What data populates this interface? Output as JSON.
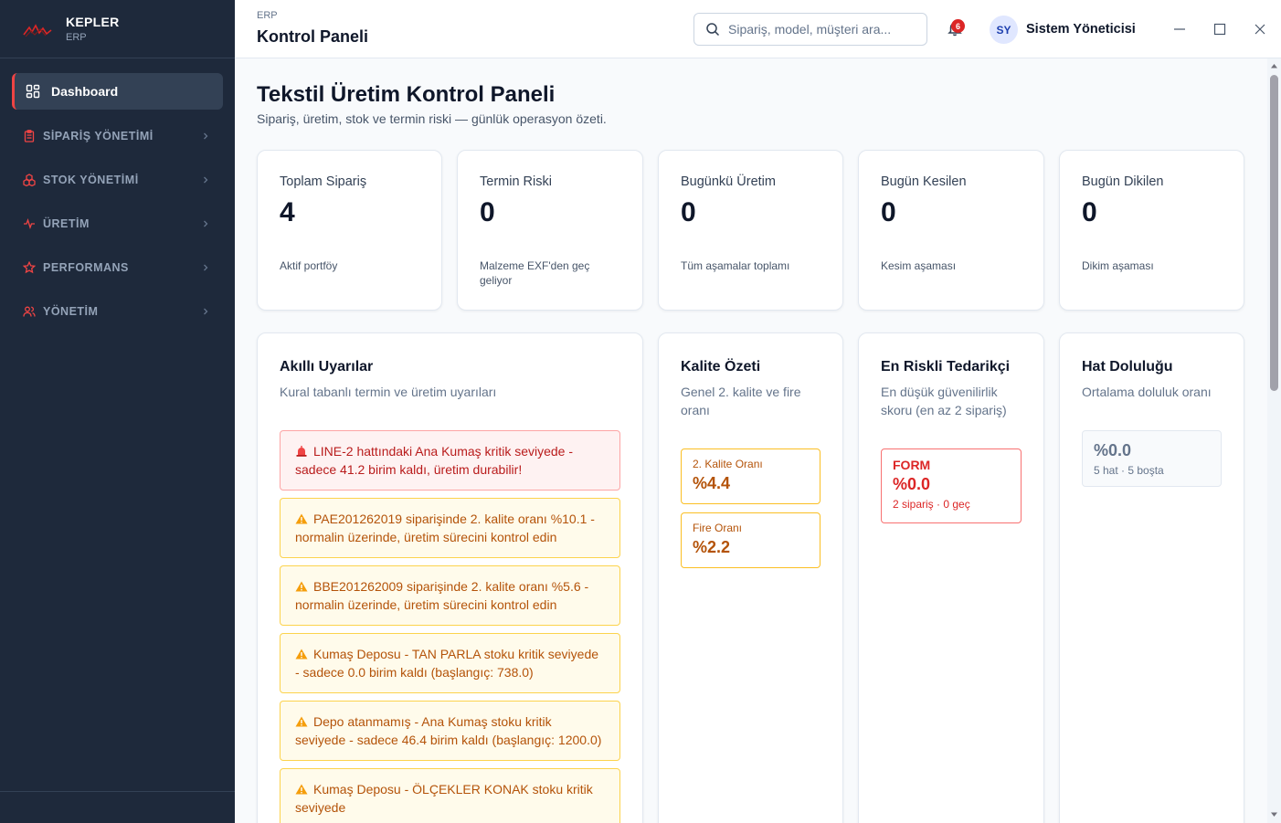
{
  "brand": {
    "name": "KEPLER",
    "sub": "ERP"
  },
  "sidebar": {
    "active": {
      "label": "Dashboard"
    },
    "items": [
      {
        "label": "SİPARİŞ YÖNETİMİ"
      },
      {
        "label": "STOK YÖNETİMİ"
      },
      {
        "label": "ÜRETİM"
      },
      {
        "label": "PERFORMANS"
      },
      {
        "label": "YÖNETİM"
      }
    ]
  },
  "header": {
    "breadcrumb": "ERP",
    "title": "Kontrol Paneli",
    "search_placeholder": "Sipariş, model, müşteri ara...",
    "notification_count": "6",
    "avatar_initials": "SY",
    "user_name": "Sistem Yöneticisi"
  },
  "page": {
    "title": "Tekstil Üretim Kontrol Paneli",
    "subtitle": "Sipariş, üretim, stok ve termin riski — günlük operasyon özeti."
  },
  "kpis": [
    {
      "label": "Toplam Sipariş",
      "value": "4",
      "note": "Aktif portföy"
    },
    {
      "label": "Termin Riski",
      "value": "0",
      "note": "Malzeme EXF'den geç geliyor"
    },
    {
      "label": "Bugünkü Üretim",
      "value": "0",
      "note": "Tüm aşamalar toplamı"
    },
    {
      "label": "Bugün Kesilen",
      "value": "0",
      "note": "Kesim aşaması"
    },
    {
      "label": "Bugün Dikilen",
      "value": "0",
      "note": "Dikim aşaması"
    }
  ],
  "alerts_card": {
    "title": "Akıllı Uyarılar",
    "subtitle": "Kural tabanlı termin ve üretim uyarıları",
    "alerts": [
      {
        "level": "critical",
        "text": "LINE-2 hattındaki Ana Kumaş kritik seviyede - sadece 41.2 birim kaldı, üretim durabilir!"
      },
      {
        "level": "warning",
        "text": "PAE201262019 siparişinde 2. kalite oranı %10.1 - normalin üzerinde, üretim sürecini kontrol edin"
      },
      {
        "level": "warning",
        "text": "BBE201262009 siparişinde 2. kalite oranı %5.6 - normalin üzerinde, üretim sürecini kontrol edin"
      },
      {
        "level": "warning",
        "text": "Kumaş Deposu - TAN PARLA stoku kritik seviyede - sadece 0.0 birim kaldı (başlangıç: 738.0)"
      },
      {
        "level": "warning",
        "text": "Depo atanmamış - Ana Kumaş stoku kritik seviyede - sadece 46.4 birim kaldı (başlangıç: 1200.0)"
      },
      {
        "level": "warning",
        "text": "Kumaş Deposu - ÖLÇEKLER KONAK stoku kritik seviyede"
      }
    ]
  },
  "quality_card": {
    "title": "Kalite Özeti",
    "subtitle": "Genel 2. kalite ve fire oranı",
    "second_quality": {
      "label": "2. Kalite Oranı",
      "value": "%4.4"
    },
    "waste": {
      "label": "Fire Oranı",
      "value": "%2.2"
    }
  },
  "supplier_card": {
    "title": "En Riskli Tedarikçi",
    "subtitle": "En düşük güvenilirlik skoru (en az 2 sipariş)",
    "supplier": {
      "name": "FORM",
      "value": "%0.0",
      "note": "2 sipariş · 0 geç"
    }
  },
  "line_card": {
    "title": "Hat Doluluğu",
    "subtitle": "Ortalama doluluk oranı",
    "occupancy": {
      "value": "%0.0",
      "note": "5 hat · 5 boşta"
    }
  },
  "colors": {
    "sidebar_bg": "#1e293b",
    "accent": "#ef4444",
    "critical": "#b91c1c",
    "warning": "#b45309"
  },
  "icons": [
    "kepler-logo-icon",
    "dashboard-grid-icon",
    "clipboard-icon",
    "boxes-icon",
    "activity-icon",
    "star-icon",
    "users-icon",
    "chevron-right-icon",
    "search-icon",
    "bell-icon",
    "minimize-icon",
    "maximize-icon",
    "close-icon",
    "siren-icon",
    "warning-icon"
  ]
}
